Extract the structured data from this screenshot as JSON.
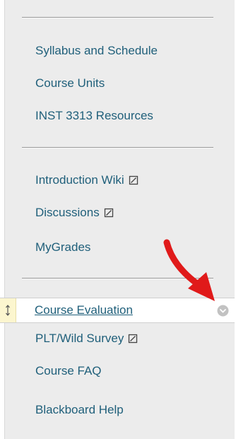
{
  "sidebar": {
    "groups": [
      {
        "items": [
          {
            "label": "Syllabus and Schedule",
            "external": false
          },
          {
            "label": "Course Units",
            "external": false
          },
          {
            "label": "INST 3313 Resources",
            "external": false
          }
        ]
      },
      {
        "items": [
          {
            "label": "Introduction Wiki",
            "external": true
          },
          {
            "label": "Discussions",
            "external": true
          },
          {
            "label": "MyGrades",
            "external": false
          }
        ]
      },
      {
        "items": [
          {
            "label": "Course Evaluation",
            "external": false,
            "active": true
          },
          {
            "label": "PLT/Wild Survey",
            "external": true
          },
          {
            "label": "Course FAQ",
            "external": false
          },
          {
            "label": "Blackboard Help",
            "external": false
          }
        ]
      }
    ]
  },
  "icons": {
    "external_link": "external-link-icon",
    "drag_handle": "drag-handle-icon",
    "context_menu": "chevron-down-icon",
    "annotation": "red-arrow-icon"
  },
  "colors": {
    "link": "#1f5f7a",
    "panel_bg": "#ececec",
    "highlight_handle": "#fcf6cf",
    "annotation_arrow": "#e01a1a"
  }
}
